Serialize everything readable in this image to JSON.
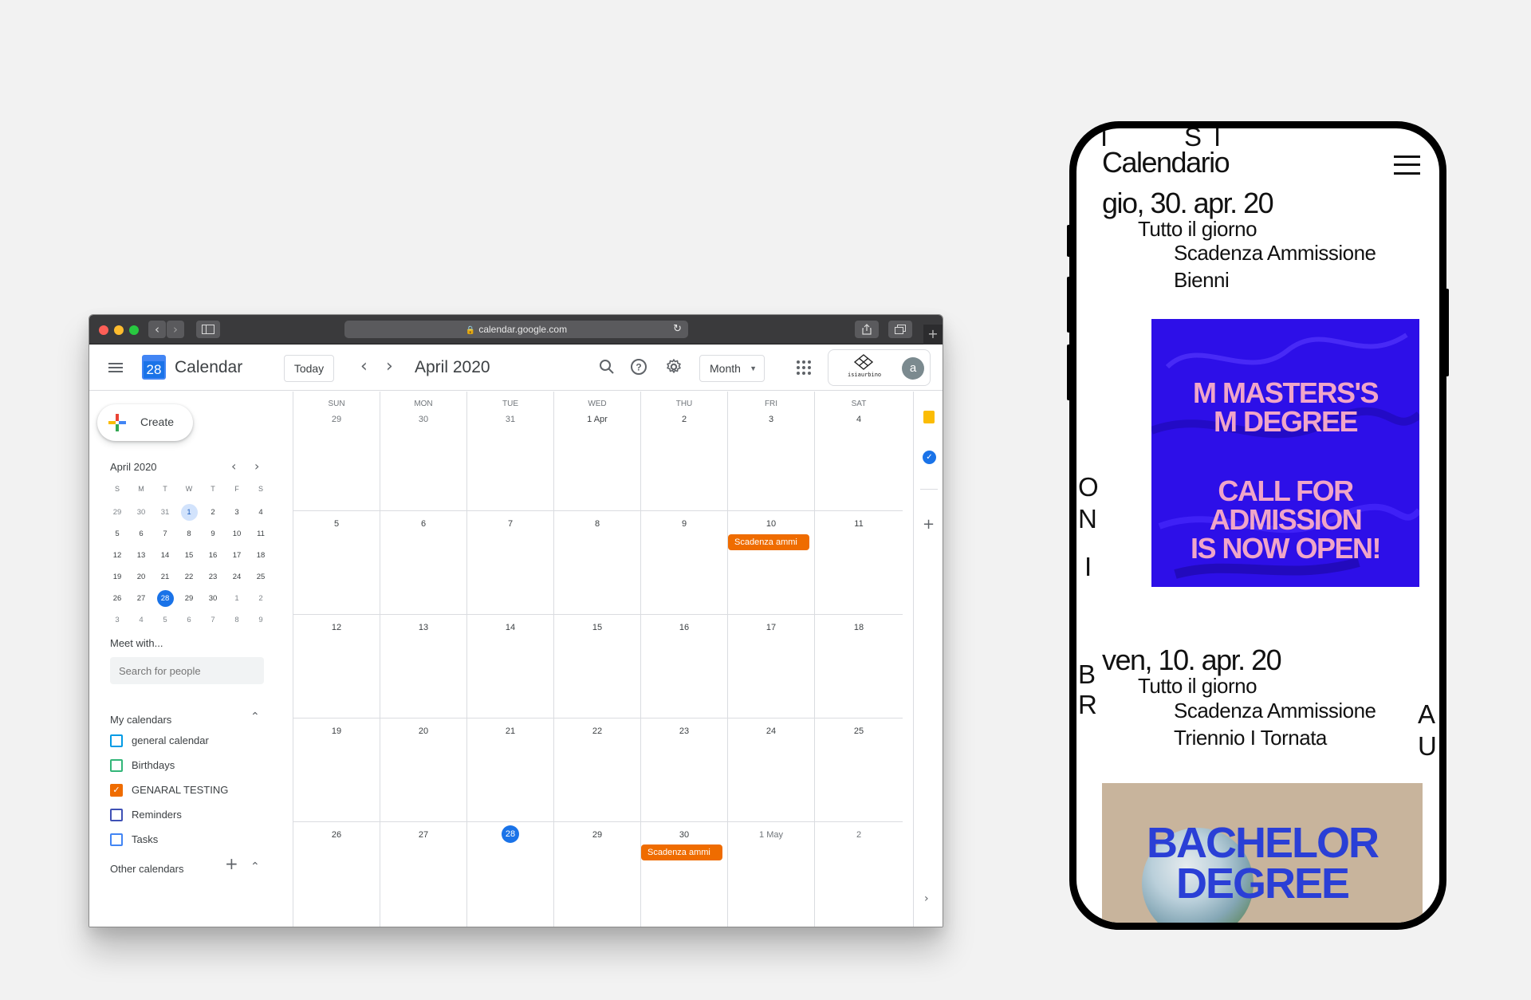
{
  "browser": {
    "url": "calendar.google.com"
  },
  "header": {
    "logo_day": "28",
    "app_title": "Calendar",
    "today_label": "Today",
    "month_title": "April 2020",
    "view_label": "Month",
    "org_name": "isiaurbino",
    "avatar_letter": "a"
  },
  "sidebar": {
    "create_label": "Create",
    "mini_title": "April 2020",
    "mini_weekdays": [
      "S",
      "M",
      "T",
      "W",
      "T",
      "F",
      "S"
    ],
    "mini_weeks": [
      [
        "29",
        "30",
        "31",
        "1",
        "2",
        "3",
        "4"
      ],
      [
        "5",
        "6",
        "7",
        "8",
        "9",
        "10",
        "11"
      ],
      [
        "12",
        "13",
        "14",
        "15",
        "16",
        "17",
        "18"
      ],
      [
        "19",
        "20",
        "21",
        "22",
        "23",
        "24",
        "25"
      ],
      [
        "26",
        "27",
        "28",
        "29",
        "30",
        "1",
        "2"
      ],
      [
        "3",
        "4",
        "5",
        "6",
        "7",
        "8",
        "9"
      ]
    ],
    "meet_label": "Meet with...",
    "search_placeholder": "Search for people",
    "my_calendars_title": "My calendars",
    "calendars": [
      {
        "label": "general calendar",
        "color": "#039be5",
        "checked": false
      },
      {
        "label": "Birthdays",
        "color": "#33b679",
        "checked": false
      },
      {
        "label": "GENARAL TESTING",
        "color": "#ef6c00",
        "checked": true
      },
      {
        "label": "Reminders",
        "color": "#3f51b5",
        "checked": false
      },
      {
        "label": "Tasks",
        "color": "#4285f4",
        "checked": false
      }
    ],
    "other_calendars_title": "Other calendars"
  },
  "month_grid": {
    "weekday_heads": [
      "SUN",
      "MON",
      "TUE",
      "WED",
      "THU",
      "FRI",
      "SAT"
    ],
    "weeks": [
      [
        "29",
        "30",
        "31",
        "1 Apr",
        "2",
        "3",
        "4"
      ],
      [
        "5",
        "6",
        "7",
        "8",
        "9",
        "10",
        "11"
      ],
      [
        "12",
        "13",
        "14",
        "15",
        "16",
        "17",
        "18"
      ],
      [
        "19",
        "20",
        "21",
        "22",
        "23",
        "24",
        "25"
      ],
      [
        "26",
        "27",
        "28",
        "29",
        "30",
        "1 May",
        "2"
      ]
    ],
    "events": [
      {
        "label": "Scadenza ammi",
        "color": "#ef6c00"
      },
      {
        "label": "Scadenza ammi",
        "color": "#ef6c00"
      }
    ]
  },
  "phone": {
    "title": "Calendario",
    "side_letters": {
      "top": [
        "I",
        "S",
        "I"
      ],
      "left_upper": [
        "O",
        "N",
        "I"
      ],
      "left_lower": [
        "B",
        "R"
      ],
      "right": [
        "A",
        "U"
      ]
    },
    "entries": [
      {
        "date": "gio, 30. apr. 20",
        "all_day": "Tutto il giorno",
        "event_line1": "Scadenza Ammissione",
        "event_line2": "Bienni",
        "poster_line1": "M MASTERS'S\nM DEGREE",
        "poster_line2": "CALL FOR\nADMISSION\nIS NOW OPEN!"
      },
      {
        "date": "ven, 10. apr. 20",
        "all_day": "Tutto il giorno",
        "event_line1": "Scadenza Ammissione",
        "event_line2": "Triennio I Tornata",
        "poster_line1": "BACHELOR\nDEGREE"
      }
    ]
  }
}
